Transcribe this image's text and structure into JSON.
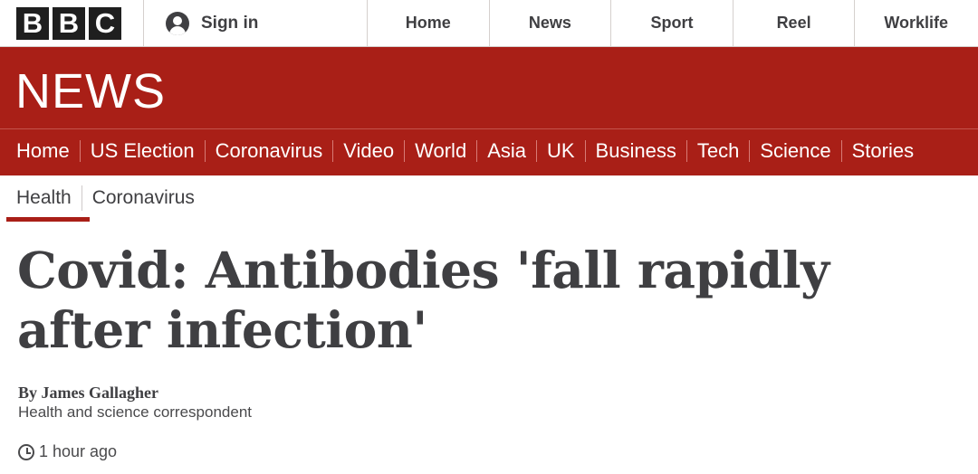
{
  "brand": {
    "letters": [
      "B",
      "B",
      "C"
    ]
  },
  "account": {
    "signin_label": "Sign in",
    "icon": "user-icon"
  },
  "top_nav": {
    "items": [
      "Home",
      "News",
      "Sport",
      "Reel",
      "Worklife"
    ]
  },
  "masthead": {
    "title": "NEWS",
    "color": "#a91f17"
  },
  "section_nav": {
    "items": [
      "Home",
      "US Election",
      "Coronavirus",
      "Video",
      "World",
      "Asia",
      "UK",
      "Business",
      "Tech",
      "Science",
      "Stories"
    ]
  },
  "sub_nav": {
    "items": [
      "Health",
      "Coronavirus"
    ],
    "active": "Health"
  },
  "article": {
    "headline": "Covid: Antibodies 'fall rapidly after infection'",
    "byline": "By James Gallagher",
    "role": "Health and science correspondent",
    "timestamp": "1 hour ago",
    "timestamp_icon": "clock-icon"
  }
}
